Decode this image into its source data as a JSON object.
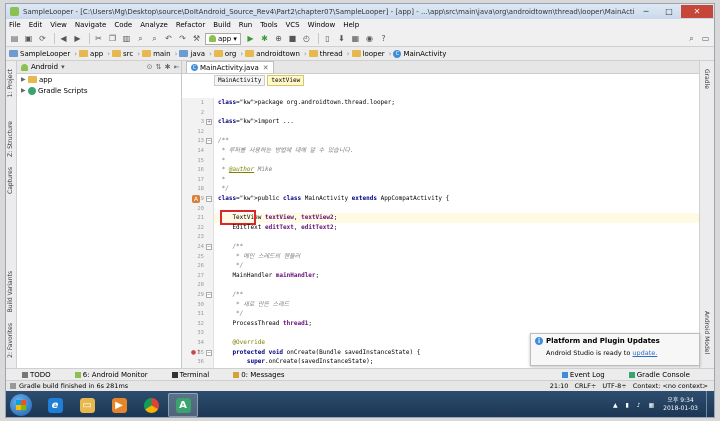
{
  "window": {
    "title": "SampleLooper - [C:\\Users\\Mg\\Desktop\\source\\DoItAndroid_Source_Rev4\\Part2\\chapter07\\SampleLooper] - [app] - ...\\app\\src\\main\\java\\org\\androidtown\\thread\\looper\\MainActivity.java - Android Studio 2.3.3",
    "minimize": "─",
    "maximize": "□",
    "close": "✕"
  },
  "menu": [
    "File",
    "Edit",
    "View",
    "Navigate",
    "Code",
    "Analyze",
    "Refactor",
    "Build",
    "Run",
    "Tools",
    "VCS",
    "Window",
    "Help"
  ],
  "toolbar": {
    "config": "app",
    "help": "?"
  },
  "breadcrumbs": [
    "SampleLooper",
    "app",
    "src",
    "main",
    "java",
    "org",
    "androidtown",
    "thread",
    "looper",
    "MainActivity"
  ],
  "left_strip": [
    "1: Project",
    "Z: Structure",
    "Captures",
    "Build Variants",
    "2: Favorites"
  ],
  "right_strip": [
    "Gradle",
    "Android Model"
  ],
  "project_panel": {
    "view": "Android",
    "items": [
      "app",
      "Gradle Scripts"
    ]
  },
  "editor": {
    "tab": "MainActivity.java",
    "close": "✕",
    "crumbs": [
      "MainActivity",
      "textView"
    ],
    "lines": [
      {
        "n": "1",
        "t": "package org.androidtown.thread.looper;"
      },
      {
        "n": "2",
        "t": ""
      },
      {
        "n": "3",
        "t": "import ..."
      },
      {
        "n": "12",
        "t": ""
      },
      {
        "n": "13",
        "t": "/**"
      },
      {
        "n": "14",
        "t": " * 루퍼를 사용하는 방법에 대해 알 수 있습니다."
      },
      {
        "n": "15",
        "t": " *"
      },
      {
        "n": "16",
        "t": " * @author Mike"
      },
      {
        "n": "17",
        "t": " *"
      },
      {
        "n": "18",
        "t": " */"
      },
      {
        "n": "19",
        "t": "public class MainActivity extends AppCompatActivity {"
      },
      {
        "n": "20",
        "t": ""
      },
      {
        "n": "21",
        "t": "    TextView textView, textView2;"
      },
      {
        "n": "22",
        "t": "    EditText editText, editText2;"
      },
      {
        "n": "23",
        "t": ""
      },
      {
        "n": "24",
        "t": "    /**"
      },
      {
        "n": "25",
        "t": "     * 메인 스레드의 핸들러"
      },
      {
        "n": "26",
        "t": "     */"
      },
      {
        "n": "27",
        "t": "    MainHandler mainHandler;"
      },
      {
        "n": "28",
        "t": ""
      },
      {
        "n": "29",
        "t": "    /**"
      },
      {
        "n": "30",
        "t": "     * 새로 만든 스레드"
      },
      {
        "n": "31",
        "t": "     */"
      },
      {
        "n": "32",
        "t": "    ProcessThread thread1;"
      },
      {
        "n": "33",
        "t": ""
      },
      {
        "n": "34",
        "t": "    @Override"
      },
      {
        "n": "35",
        "t": "    protected void onCreate(Bundle savedInstanceState) {"
      },
      {
        "n": "36",
        "t": "        super.onCreate(savedInstanceState);"
      }
    ]
  },
  "notification": {
    "title": "Platform and Plugin Updates",
    "body": "Android Studio is ready to",
    "link": "update."
  },
  "bottom_tabs": [
    "TODO",
    "6: Android Monitor",
    "Terminal",
    "0: Messages"
  ],
  "bottom_right_tabs": [
    "Event Log",
    "Gradle Console"
  ],
  "status": {
    "message": "Gradle build finished in 6s 281ms",
    "position": "21:10",
    "line_sep": "CRLF÷",
    "encoding": "UTF-8÷",
    "context": "Context: <no context>"
  },
  "taskbar": {
    "time": "오후 9:34",
    "date": "2018-01-03"
  },
  "colors": {
    "highlight_box": "#d9282c",
    "keyword": "#000080",
    "current_line": "#fffae3"
  }
}
